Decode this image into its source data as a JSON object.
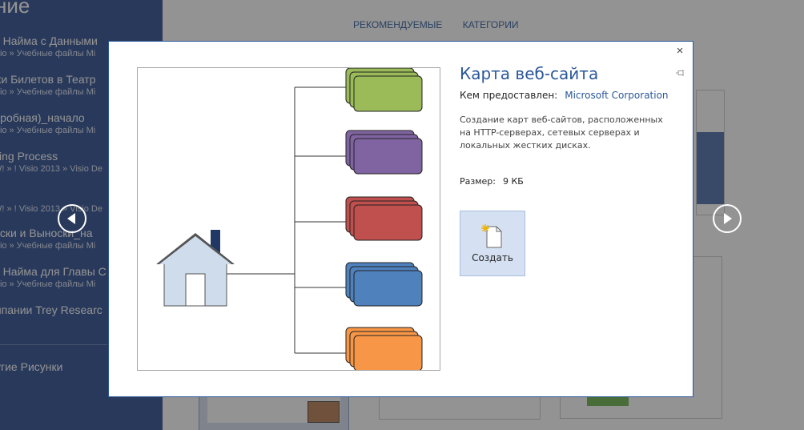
{
  "sidebar": {
    "heading": "ние",
    "items": [
      {
        "title": "а Найма с Данными",
        "path": "isio » Учебные файлы Mi"
      },
      {
        "title": "жи Билетов в Театр",
        "path": "isio » Учебные файлы Mi"
      },
      {
        "title": "дробная)_начало",
        "path": "isio » Учебные файлы Mi"
      },
      {
        "title": "king Process",
        "path": "W! » ! Visio 2013 » Visio De"
      },
      {
        "title": "",
        "path": "W! » ! Visio 2013 » Visio De"
      },
      {
        "title": "иски и Выноски_на",
        "path": "isio » Учебные файлы Mi"
      },
      {
        "title": "а Найма для Главы С",
        "path": "isio » Учебные файлы Mi"
      },
      {
        "title": "мпании Trey Researc",
        "path": ""
      }
    ],
    "more_label": "угие Рисунки"
  },
  "tabs": [
    "РЕКОМЕНДУЕМЫЕ",
    "КАТЕГОРИИ"
  ],
  "modal": {
    "close_glyph": "×",
    "title": "Карта веб-сайта",
    "provider_label": "Кем предоставлен:",
    "provider_name": "Microsoft Corporation",
    "description": "Создание карт веб-сайтов, расположенных на HTTP-серверах, сетевых серверах и локальных жестких дисках.",
    "size_label": "Размер:",
    "size_value": "9 КБ",
    "create_label": "Создать"
  },
  "preview": {
    "stack_colors": [
      "#9bbb59",
      "#8064a2",
      "#c0504d",
      "#4f81bd",
      "#f79646"
    ],
    "house_fill": "#cfdcec"
  },
  "colors": {
    "accent": "#2b579a",
    "sidebar": "#2b4a8f"
  },
  "icons": {
    "prev": "chevron-left-circle-icon",
    "next": "chevron-right-circle-icon",
    "create": "new-document-icon",
    "pin": "pin-icon",
    "close": "close-icon"
  }
}
